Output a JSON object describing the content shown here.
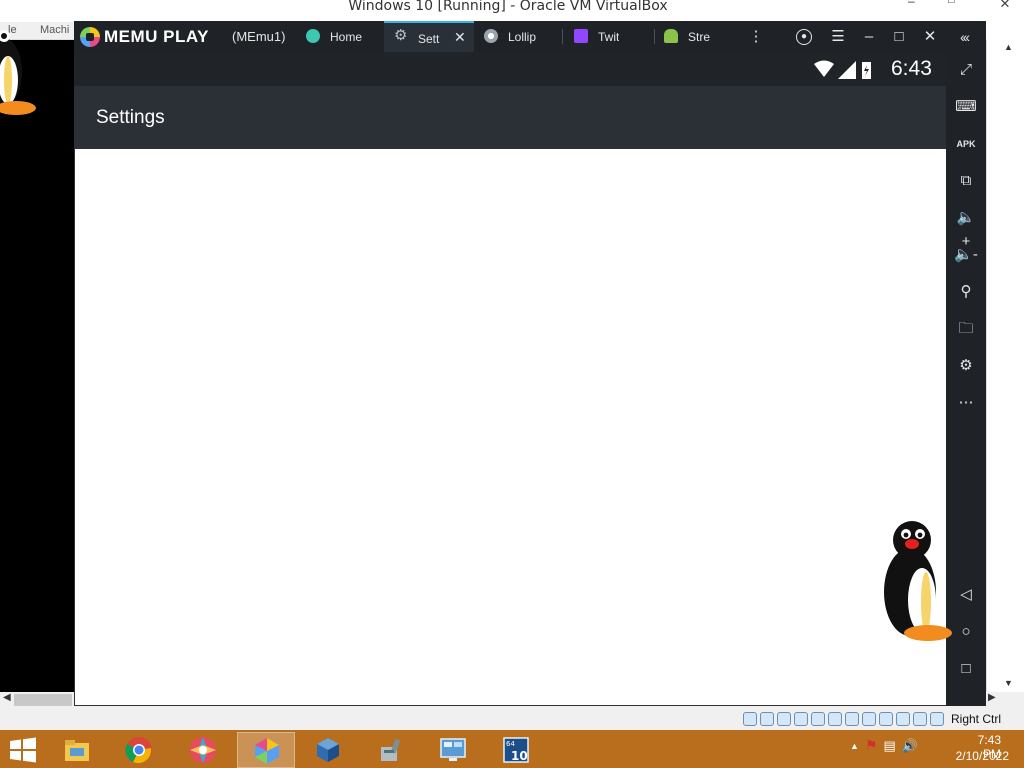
{
  "vbox": {
    "title": "Windows 10 [Running] - Oracle VM VirtualBox",
    "menu": [
      "le",
      "Machi"
    ],
    "status_host_key": "Right Ctrl"
  },
  "memu": {
    "brand": "MEMU PLAY",
    "instance": "(MEmu1)",
    "tabs": [
      {
        "label": "Home",
        "icon": "memu-home-icon",
        "color": "#3ec6b1"
      },
      {
        "label": "Sett",
        "icon": "settings-gear-icon",
        "color": "#9aa4ad",
        "active": true
      },
      {
        "label": "Lollip",
        "icon": "chrome-icon",
        "color": "#cccccc"
      },
      {
        "label": "Twit",
        "icon": "twitch-icon",
        "color": "#9146ff"
      },
      {
        "label": "Stre",
        "icon": "android-icon",
        "color": "#8bc34a"
      }
    ]
  },
  "android": {
    "time": "6:43",
    "settings_title": "Settings"
  },
  "taskbar": {
    "time": "7:43 PM",
    "date": "2/10/2022",
    "apps": [
      "file-explorer-icon",
      "chrome-icon",
      "photos-app-icon",
      "memu-app-icon",
      "virtualbox-icon",
      "tools-icon",
      "system-monitor-icon",
      "windows10-app-icon"
    ]
  }
}
